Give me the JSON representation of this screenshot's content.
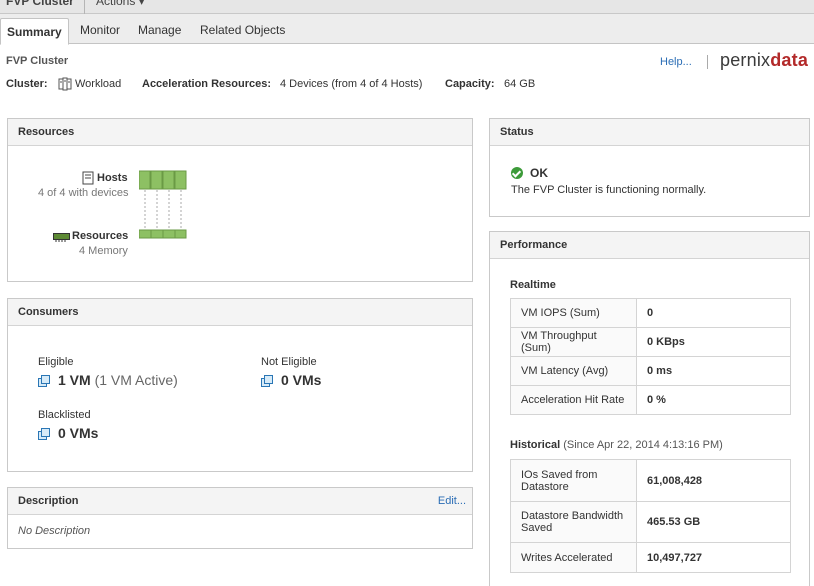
{
  "header": {
    "object_name": "FVP Cluster",
    "actions_label": "Actions ▾"
  },
  "tabs": [
    {
      "label": "Summary"
    },
    {
      "label": "Monitor"
    },
    {
      "label": "Manage"
    },
    {
      "label": "Related Objects"
    }
  ],
  "summary": {
    "title": "FVP Cluster",
    "help_label": "Help...",
    "logo": {
      "part1": "pernix",
      "part2": "data"
    },
    "cluster_label": "Cluster:",
    "cluster_value": "Workload",
    "accel_label": "Acceleration Resources:",
    "accel_value": "4 Devices (from 4 of 4 Hosts)",
    "capacity_label": "Capacity:",
    "capacity_value": "64 GB"
  },
  "resources": {
    "title": "Resources",
    "hosts_label": "Hosts",
    "hosts_sub": "4 of 4 with devices",
    "res_label": "Resources",
    "res_sub": "4 Memory"
  },
  "consumers": {
    "title": "Consumers",
    "eligible_label": "Eligible",
    "eligible_value": "1 VM",
    "eligible_note": "(1 VM Active)",
    "not_eligible_label": "Not Eligible",
    "not_eligible_value": "0 VMs",
    "blacklisted_label": "Blacklisted",
    "blacklisted_value": "0 VMs"
  },
  "description": {
    "title": "Description",
    "edit_label": "Edit...",
    "text": "No Description"
  },
  "status": {
    "title": "Status",
    "state": "OK",
    "message": "The FVP Cluster is functioning normally."
  },
  "performance": {
    "title": "Performance",
    "realtime_title": "Realtime",
    "realtime": [
      {
        "k": "VM IOPS (Sum)",
        "v": "0"
      },
      {
        "k": "VM Throughput (Sum)",
        "v": "0 KBps"
      },
      {
        "k": "VM Latency (Avg)",
        "v": "0 ms"
      },
      {
        "k": "Acceleration Hit Rate",
        "v": "0 %"
      }
    ],
    "historical_title": "Historical",
    "historical_note": "(Since Apr 22, 2014 4:13:16 PM)",
    "historical": [
      {
        "k1": "IOs Saved from",
        "k2": "Datastore",
        "v": "61,008,428"
      },
      {
        "k1": "Datastore Bandwidth",
        "k2": "Saved",
        "v": "465.53 GB"
      },
      {
        "k1": "Writes Accelerated",
        "k2": "",
        "v": "10,497,727"
      }
    ]
  }
}
